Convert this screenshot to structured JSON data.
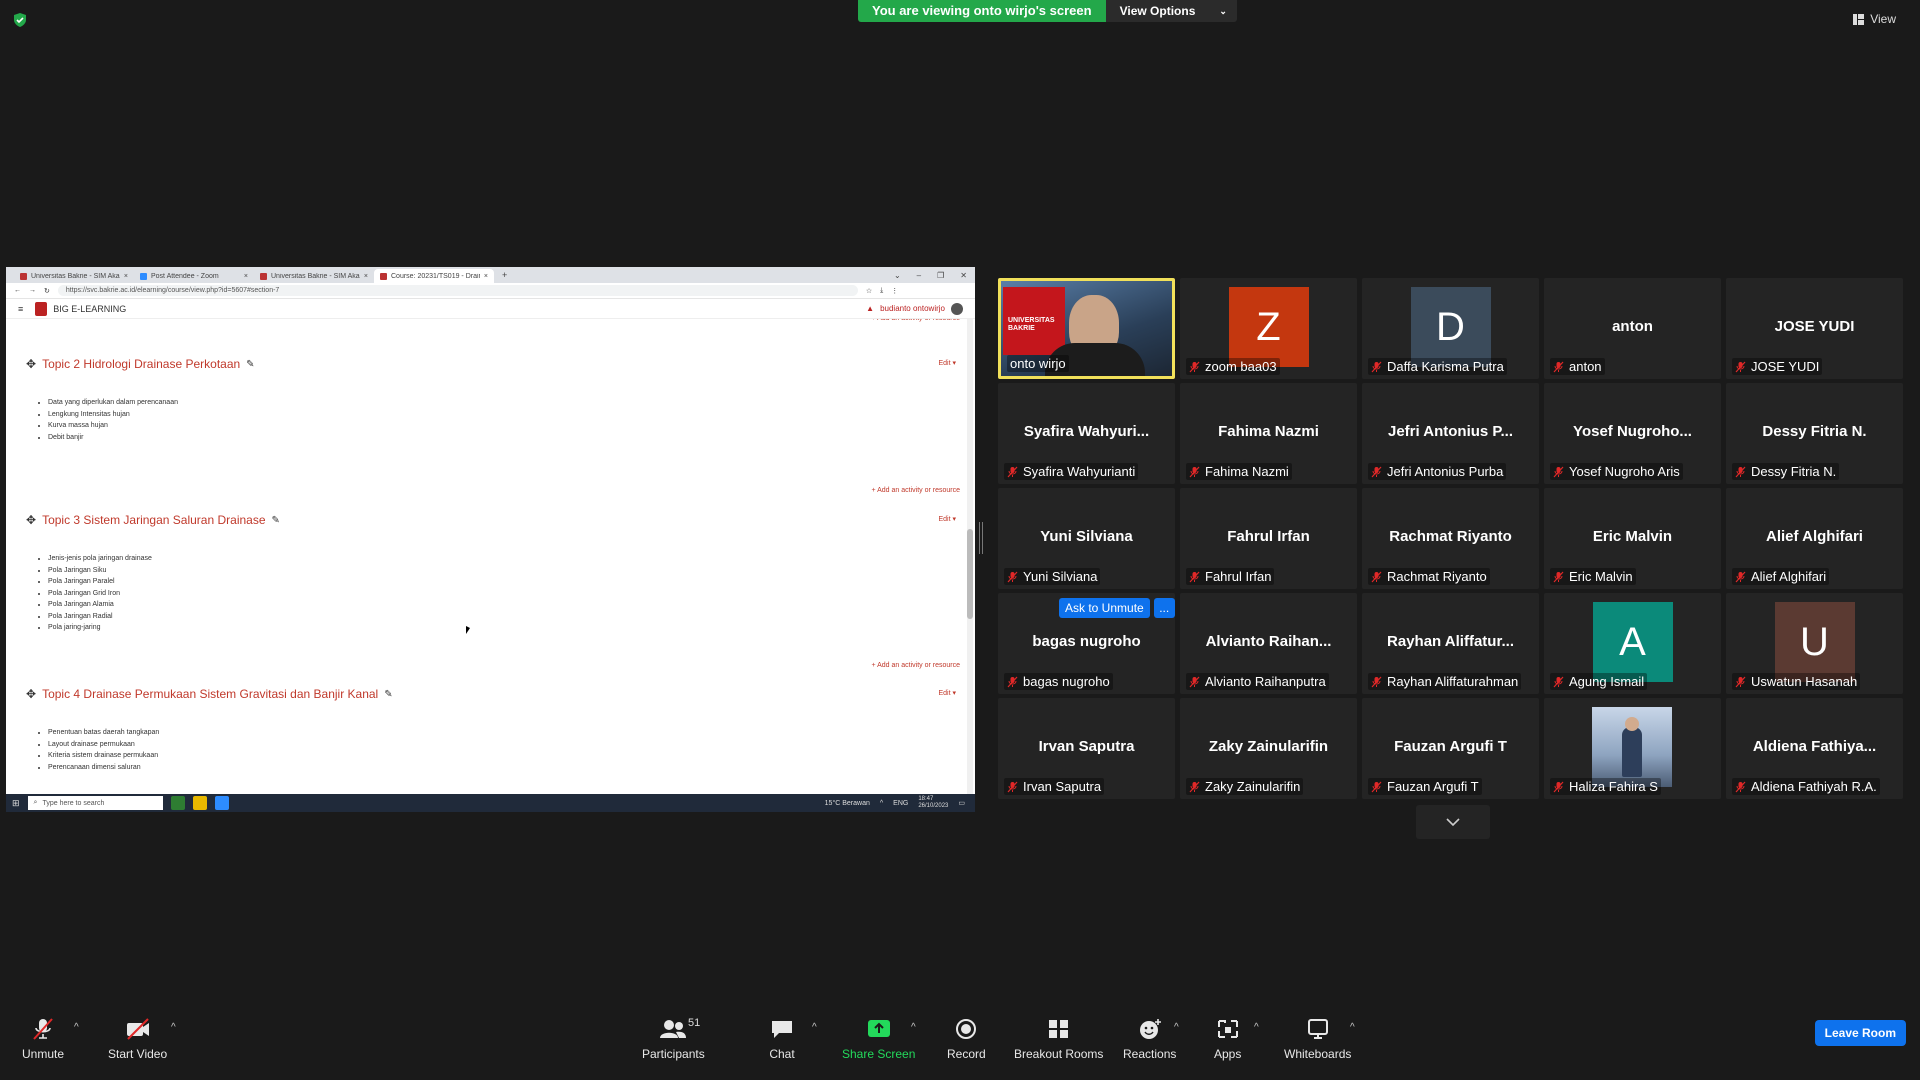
{
  "meeting": {
    "banner_text": "You are viewing onto wirjo's screen",
    "view_options_label": "View Options",
    "view_label": "View"
  },
  "browser": {
    "tabs": [
      {
        "label": "Universitas Bakrie - SIM Akademik",
        "active": false
      },
      {
        "label": "Post Attendee - Zoom",
        "active": false
      },
      {
        "label": "Universitas Bakrie - SIM Akademik",
        "active": false
      },
      {
        "label": "Course: 20231/TS019 - Drainase...",
        "active": true
      }
    ],
    "url": "https://svc.bakrie.ac.id/elearning/course/view.php?id=5607#section-7"
  },
  "moodle": {
    "brand": "BIG E-LEARNING",
    "user": "budianto ontowirjo",
    "add_activity": "Add an activity or resource",
    "edit_label": "Edit",
    "topics": [
      {
        "title": "Topic 2 Hidrologi Drainase Perkotaan",
        "items": [
          "Data yang diperlukan dalam perencanaan",
          "Lengkung Intensitas hujan",
          "Kurva massa hujan",
          "Debit banjir"
        ]
      },
      {
        "title": "Topic 3 Sistem Jaringan Saluran Drainase",
        "items": [
          "Jenis-jenis pola jaringan drainase",
          "Pola Jaringan Siku",
          "Pola Jaringan Paralel",
          "Pola Jaringan Grid Iron",
          "Pola Jaringan Alamia",
          "Pola Jaringan Radial",
          "Pola jaring-jaring"
        ]
      },
      {
        "title": "Topic 4 Drainase Permukaan Sistem Gravitasi dan Banjir Kanal",
        "items": [
          "Penentuan batas daerah tangkapan",
          "Layout drainase permukaan",
          "Kriteria sistem drainase permukaan",
          "Perencanaan dimensi saluran"
        ]
      }
    ]
  },
  "taskbar": {
    "search_placeholder": "Type here to search",
    "weather": "15°C Berawan",
    "lang": "ENG",
    "time": "18:47",
    "date": "26/10/2023"
  },
  "participants_tiles": [
    {
      "display": "",
      "name": "onto wirjo",
      "type": "video",
      "active": true
    },
    {
      "display": "Z",
      "name": "zoom baa03",
      "type": "letter",
      "color": "#c4370f"
    },
    {
      "display": "D",
      "name": "Daffa Karisma Putra",
      "type": "letter",
      "color": "#3b4b5b"
    },
    {
      "display": "anton",
      "name": "anton",
      "type": "text"
    },
    {
      "display": "JOSE YUDI",
      "name": "JOSE YUDI",
      "type": "text"
    },
    {
      "display": "Syafira  Wahyuri...",
      "name": "Syafira Wahyurianti",
      "type": "text"
    },
    {
      "display": "Fahima Nazmi",
      "name": "Fahima Nazmi",
      "type": "text"
    },
    {
      "display": "Jefri Antonius P...",
      "name": "Jefri Antonius Purba",
      "type": "text"
    },
    {
      "display": "Yosef  Nugroho...",
      "name": "Yosef Nugroho Aris",
      "type": "text"
    },
    {
      "display": "Dessy Fitria N.",
      "name": "Dessy Fitria N.",
      "type": "text"
    },
    {
      "display": "Yuni Silviana",
      "name": "Yuni Silviana",
      "type": "text"
    },
    {
      "display": "Fahrul Irfan",
      "name": "Fahrul Irfan",
      "type": "text"
    },
    {
      "display": "Rachmat Riyanto",
      "name": "Rachmat Riyanto",
      "type": "text"
    },
    {
      "display": "Eric Malvin",
      "name": "Eric Malvin",
      "type": "text"
    },
    {
      "display": "Alief Alghifari",
      "name": "Alief Alghifari",
      "type": "text"
    },
    {
      "display": "bagas nugroho",
      "name": "bagas nugroho",
      "type": "text"
    },
    {
      "display": "Alvianto  Raihan...",
      "name": "Alvianto Raihanputra",
      "type": "text"
    },
    {
      "display": "Rayhan  Aliffatur...",
      "name": "Rayhan Aliffaturahman",
      "type": "text"
    },
    {
      "display": "A",
      "name": "Agung Ismail",
      "type": "letter",
      "color": "#0b8a7a"
    },
    {
      "display": "U",
      "name": "Uswatun Hasanah",
      "type": "letter",
      "color": "#5b3a32"
    },
    {
      "display": "Irvan Saputra",
      "name": "Irvan Saputra",
      "type": "text"
    },
    {
      "display": "Zaky Zainularifin",
      "name": "Zaky Zainularifin",
      "type": "text"
    },
    {
      "display": "Fauzan Argufi T",
      "name": "Fauzan Argufi T",
      "type": "text"
    },
    {
      "display": "",
      "name": "Haliza Fahira S",
      "type": "photo"
    },
    {
      "display": "Aldiena  Fathiya...",
      "name": "Aldiena Fathiyah R.A.",
      "type": "text"
    }
  ],
  "hover": {
    "ask_unmute": "Ask to Unmute",
    "more": "..."
  },
  "toolbar": {
    "unmute": "Unmute",
    "start_video": "Start Video",
    "participants": "Participants",
    "participant_count": "51",
    "chat": "Chat",
    "share_screen": "Share Screen",
    "record": "Record",
    "breakout_rooms": "Breakout Rooms",
    "reactions": "Reactions",
    "apps": "Apps",
    "whiteboards": "Whiteboards",
    "leave_room": "Leave Room"
  },
  "colors": {
    "banner_green": "#23a84a",
    "accent_blue": "#0e72ed",
    "active_speaker": "#f1e05a",
    "mute_red": "#e02828"
  }
}
